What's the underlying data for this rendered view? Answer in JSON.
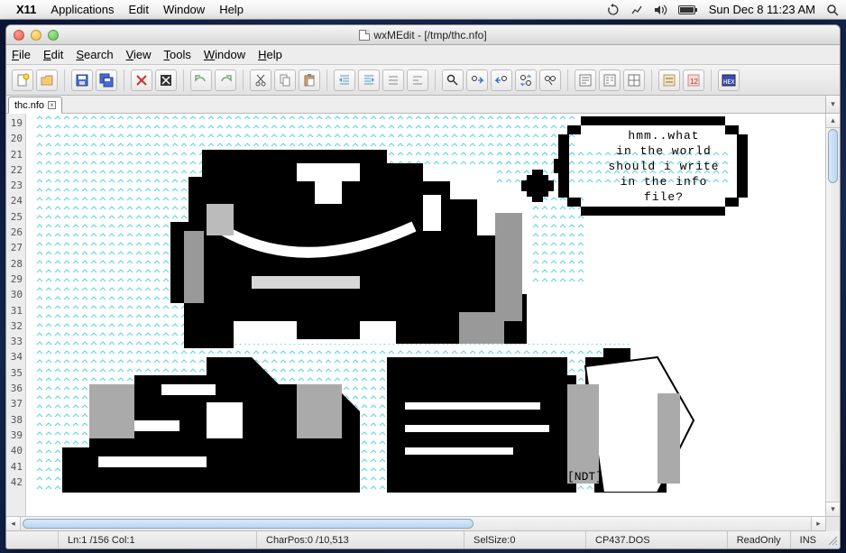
{
  "mac_menu": {
    "app": "X11",
    "items": [
      "Applications",
      "Edit",
      "Window",
      "Help"
    ],
    "clock": "Sun Dec 8  11:23 AM"
  },
  "window": {
    "title": "wxMEdit - [/tmp/thc.nfo]"
  },
  "app_menu": {
    "file": "File",
    "edit": "Edit",
    "search": "Search",
    "view": "View",
    "tools": "Tools",
    "window": "Window",
    "help": "Help"
  },
  "tab": {
    "label": "thc.nfo"
  },
  "editor": {
    "line_start": 19,
    "line_end": 42,
    "bubble_l1": "hmm..what",
    "bubble_l2": "in the world",
    "bubble_l3": "should i write",
    "bubble_l4": "in the info",
    "bubble_l5": "file?",
    "signature": "[NDT]"
  },
  "status": {
    "pos": "Ln:1 /156 Col:1",
    "charpos": "CharPos:0 /10,513",
    "selsize": "SelSize:0",
    "encoding": "CP437.DOS",
    "readonly": "ReadOnly",
    "insert": "INS"
  }
}
